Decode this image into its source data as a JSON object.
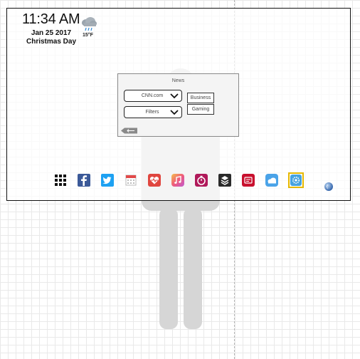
{
  "clock": {
    "time": "11:34 AM",
    "date": "Jan 25 2017",
    "holiday": "Christmas Day"
  },
  "weather": {
    "icon": "rain-cloud-icon",
    "temperature": "15°F"
  },
  "news_widget": {
    "title": "News",
    "source_dropdown": "CNN.com",
    "filter_dropdown": "Filters",
    "categories": [
      "Business",
      "Gaming"
    ],
    "back_icon": "back-arrow-icon"
  },
  "dock": {
    "icons": [
      "apps-grid-icon",
      "facebook-icon",
      "twitter-icon",
      "calendar-icon",
      "health-icon",
      "music-icon",
      "timer-icon",
      "layers-icon",
      "news-icon",
      "weather-icon",
      "settings-icon"
    ],
    "selected": "settings-icon",
    "extra_icon": "globe-icon"
  },
  "colors": {
    "facebook": "#3b5998",
    "twitter": "#1da1f2",
    "health": "#e0463f",
    "music_start": "#f5c04a",
    "music_end": "#c05bd0",
    "timer": "#b0195a",
    "layers": "#2b2b2b",
    "news": "#c8102e",
    "weather": "#4aa3e8",
    "settings": "#47a3e0",
    "selection": "#e6b800",
    "silhouette": "#d9d9d9"
  }
}
